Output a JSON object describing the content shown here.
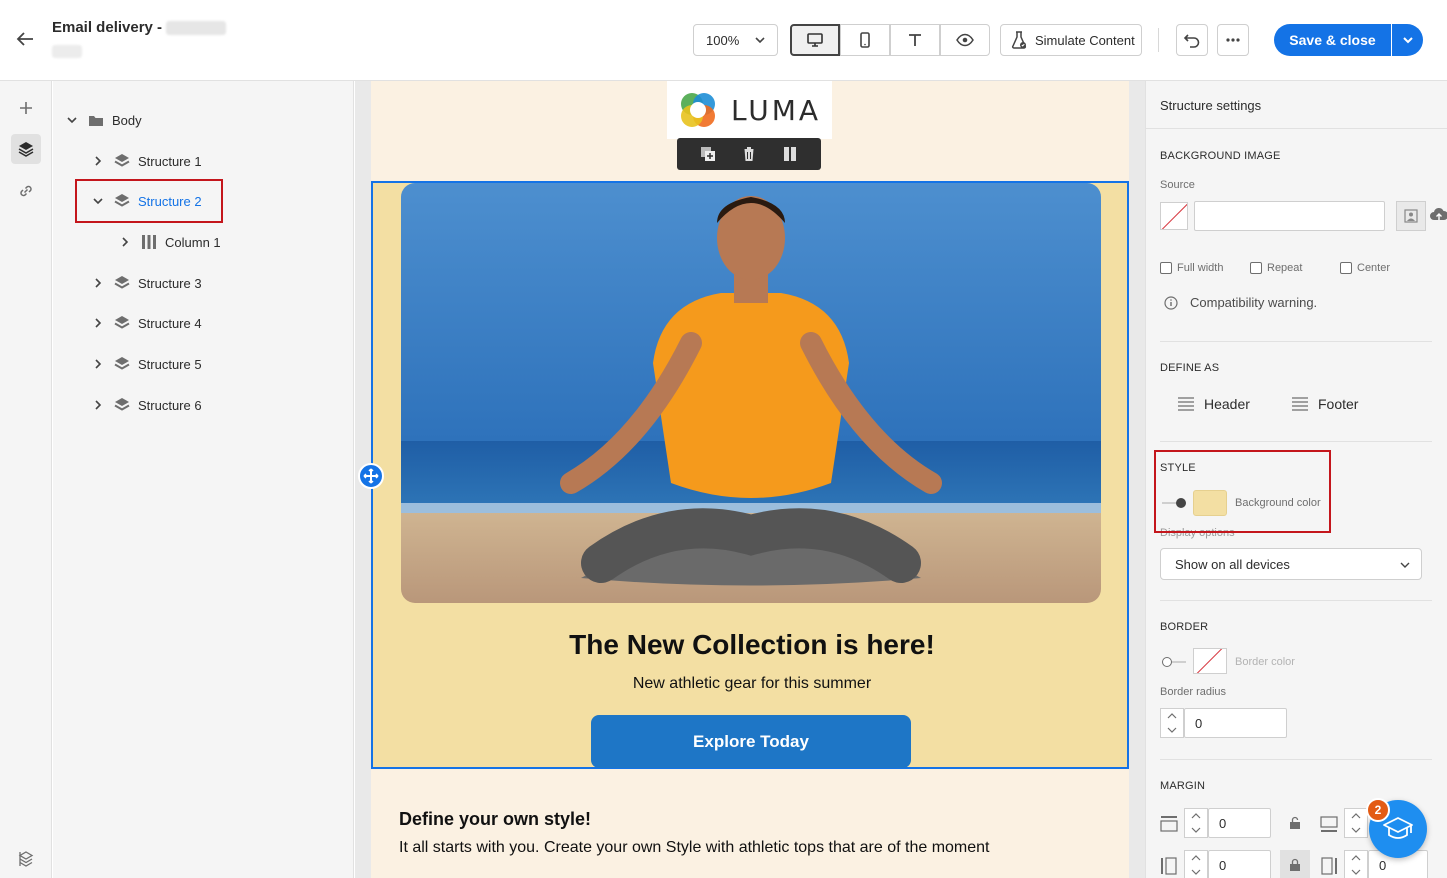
{
  "header": {
    "title": "Email delivery -",
    "zoom": "100%",
    "simulate_label": "Simulate Content",
    "save_label": "Save & close"
  },
  "tree": {
    "root": "Body",
    "items": [
      {
        "label": "Structure 1"
      },
      {
        "label": "Structure 2"
      },
      {
        "label": "Column 1"
      },
      {
        "label": "Structure 3"
      },
      {
        "label": "Structure 4"
      },
      {
        "label": "Structure 5"
      },
      {
        "label": "Structure 6"
      }
    ]
  },
  "email": {
    "logo_text": "LUMA",
    "headline": "The New Collection is here!",
    "subline": "New athletic gear for this summer",
    "cta": "Explore Today",
    "section2_title": "Define your own style!",
    "section2_text": "It all starts with you. Create your own Style with athletic tops that are of the moment"
  },
  "panel": {
    "title": "Structure settings",
    "background_image": {
      "label": "BACKGROUND IMAGE",
      "source_label": "Source",
      "source_value": "",
      "full_width": "Full width",
      "repeat": "Repeat",
      "center": "Center",
      "warning": "Compatibility warning."
    },
    "define_as": {
      "label": "DEFINE AS",
      "header": "Header",
      "footer": "Footer"
    },
    "style": {
      "label": "STYLE",
      "background_color_label": "Background color",
      "background_color": "#f3dfa3",
      "display_options_label": "Display options",
      "display_value": "Show on all devices"
    },
    "border": {
      "label": "BORDER",
      "color_label": "Border color",
      "radius_label": "Border radius",
      "radius_value": "0"
    },
    "margin": {
      "label": "MARGIN",
      "top": "0",
      "right": "0",
      "left": "0",
      "bottom": "0"
    }
  },
  "help": {
    "badge": "2"
  },
  "colors": {
    "accent": "#1473e6",
    "highlight": "#c4161c",
    "structure_bg": "#f3dfa3",
    "email_bg": "#fbf1e2",
    "cta": "#1e76c6"
  }
}
